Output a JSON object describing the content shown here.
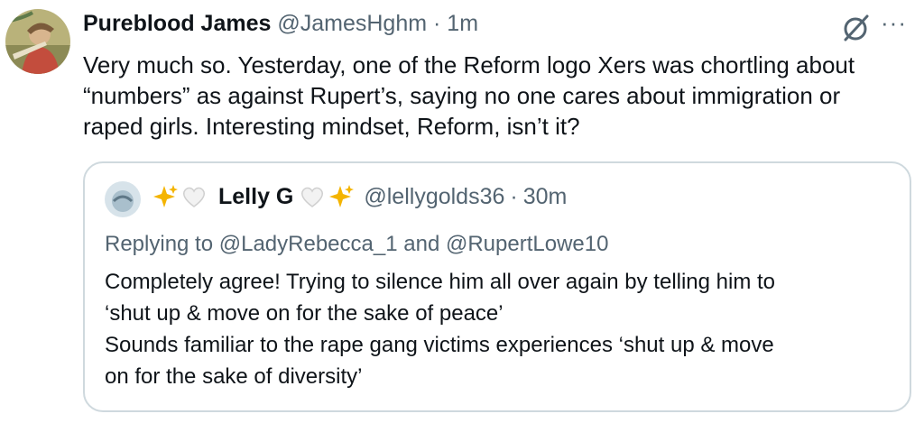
{
  "tweet": {
    "author_name": "Pureblood James",
    "handle": "@JamesHghm",
    "separator": "·",
    "time": "1m",
    "more_label": "···",
    "text_lines": [
      "Very much so. Yesterday, one of the Reform logo Xers was chortling about",
      "“numbers” as against Rupert’s, saying no one cares about immigration or",
      "raped girls. Interesting mindset, Reform, isn’t it?"
    ]
  },
  "quote": {
    "author_name": "Lelly G",
    "handle": "@lellygolds36",
    "separator": "·",
    "time": "30m",
    "replying_to_prefix": "Replying to",
    "replying_to_user1": "@LadyRebecca_1",
    "replying_to_and": "and",
    "replying_to_user2": "@RupertLowe10",
    "text_lines": [
      "Completely agree! Trying to silence him all over again by telling him to",
      "‘shut up & move on for the sake of peace’",
      "Sounds familiar to the rape gang victims experiences ‘shut up & move",
      "on for the sake of diversity’"
    ]
  },
  "icons": {
    "avatar": "avatar-image",
    "grok": "grok-slash-circle-icon",
    "more": "more-dots-icon",
    "sparkles": "sparkles-emoji",
    "white_heart": "white-heart-emoji"
  },
  "colors": {
    "text": "#0f1419",
    "muted": "#536471",
    "border": "#cfd9de",
    "sparkle": "#f4b400"
  }
}
